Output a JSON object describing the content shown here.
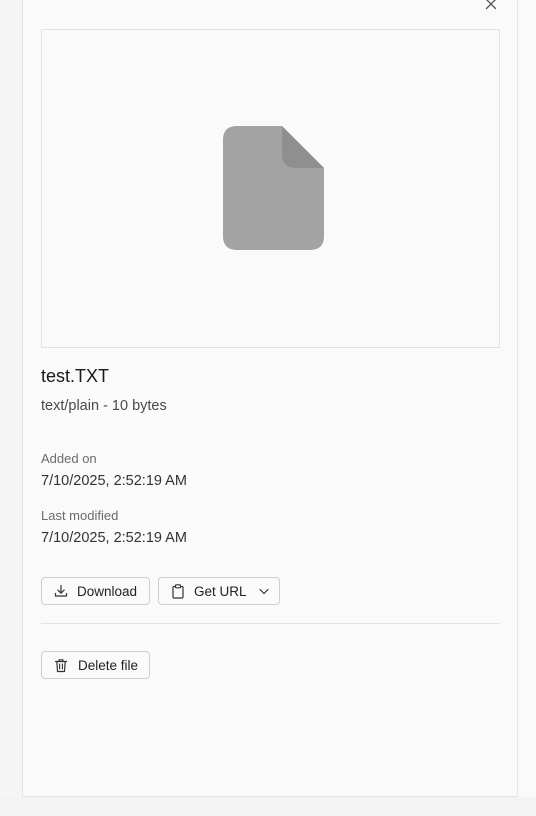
{
  "file": {
    "name": "test.TXT",
    "meta": "text/plain - 10 bytes"
  },
  "details": {
    "added_label": "Added on",
    "added_value": "7/10/2025, 2:52:19 AM",
    "modified_label": "Last modified",
    "modified_value": "7/10/2025, 2:52:19 AM"
  },
  "actions": {
    "download_label": "Download",
    "get_url_label": "Get URL",
    "delete_label": "Delete file"
  },
  "icons": {
    "close": "close-icon",
    "file": "file-icon",
    "download": "download-icon",
    "clipboard": "clipboard-icon",
    "chevron": "chevron-down-icon",
    "trash": "trash-icon"
  },
  "colors": {
    "file_icon": "#a3a3a3",
    "file_icon_fold": "#8f8f8f"
  }
}
